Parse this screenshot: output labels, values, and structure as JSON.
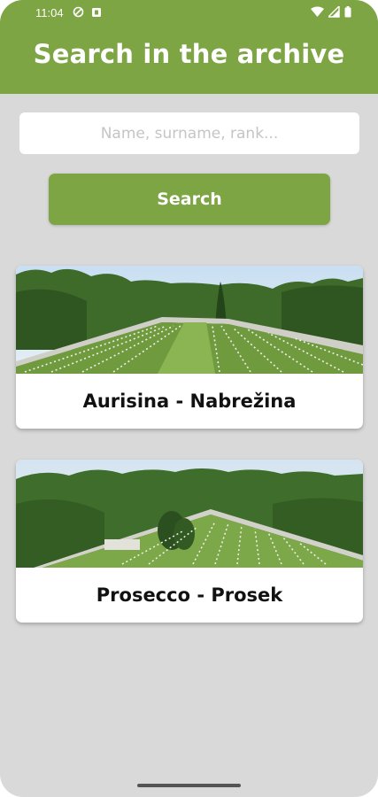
{
  "status_bar": {
    "time": "11:04",
    "left_icons": [
      "vpn-shield-icon",
      "notification-app-icon"
    ],
    "right_icons": [
      "wifi-icon",
      "cell-signal-icon",
      "battery-icon"
    ]
  },
  "header": {
    "title": "Search in the archive"
  },
  "search": {
    "value": "",
    "placeholder": "Name, surname, rank...",
    "button_label": "Search"
  },
  "cemeteries": [
    {
      "label": "Aurisina - Nabrežina",
      "image": "cemetery-aurisina-photo"
    },
    {
      "label": "Prosecco - Prosek",
      "image": "cemetery-prosecco-photo"
    }
  ],
  "colors": {
    "accent": "#7da544",
    "background": "#d9d9d9",
    "card": "#ffffff"
  }
}
